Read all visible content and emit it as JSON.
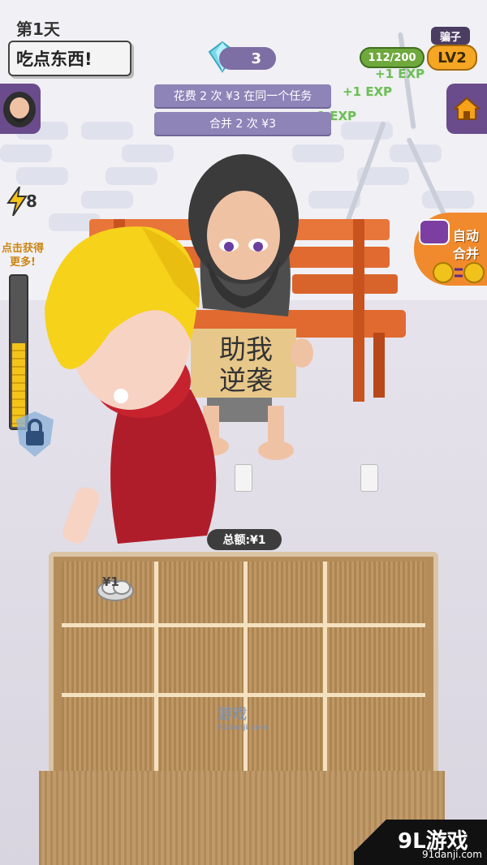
{
  "hud": {
    "day_label": "第1天",
    "speech": "吃点东西!",
    "gems": "3",
    "title_badge": "骗子",
    "xp": "112/200",
    "level": "LV2",
    "exp_float": "+1 EXP",
    "exp_float_2": "+1 EXP",
    "exp_float_3": "+1 EXP",
    "energy": "8",
    "tap_label_1": "点击获得",
    "tap_label_2": "更多!",
    "meter_fraction": 0.55
  },
  "tasks": [
    {
      "label": "花费 2 次 ¥3 在同一个任务"
    },
    {
      "label": "合并 2 次 ¥3"
    }
  ],
  "side_button": {
    "line1": "自动",
    "line2": "合并"
  },
  "sign_text": {
    "line1": "助我",
    "line2": "逆袭"
  },
  "total": "总额:¥1",
  "grid": {
    "rows": 3,
    "cols": 4,
    "items": [
      {
        "row": 0,
        "col": 0,
        "label": "¥1"
      }
    ]
  },
  "watermark": {
    "center": "游戏",
    "center_sub": "91danji.com",
    "brand": "9L游戏",
    "brand_url": "91danji.com"
  },
  "colors": {
    "accent_purple": "#6a4c8c",
    "xp_green": "#6fa83c",
    "level_orange": "#f5a623",
    "task_purple": "#8e84b8"
  }
}
